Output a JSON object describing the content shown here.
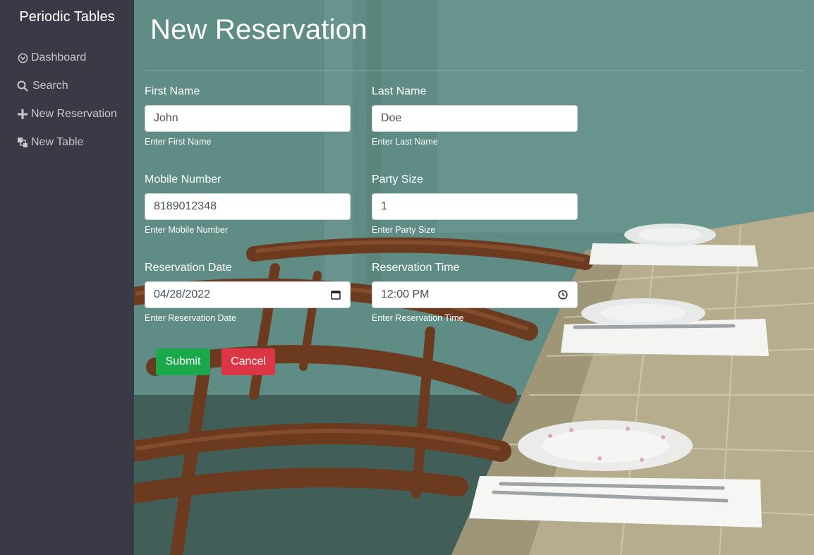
{
  "sidebar": {
    "brand": "Periodic Tables",
    "items": [
      {
        "label": "Dashboard",
        "icon": "dashboard-icon"
      },
      {
        "label": "Search",
        "icon": "search-icon"
      },
      {
        "label": "New Reservation",
        "icon": "plus-icon"
      },
      {
        "label": "New Table",
        "icon": "layers-icon"
      }
    ]
  },
  "main": {
    "title": "New Reservation",
    "form": {
      "first_name": {
        "label": "First Name",
        "value": "John",
        "hint": "Enter First Name"
      },
      "last_name": {
        "label": "Last Name",
        "value": "Doe",
        "hint": "Enter Last Name"
      },
      "mobile_number": {
        "label": "Mobile Number",
        "value": "8189012348",
        "hint": "Enter Mobile Number"
      },
      "party_size": {
        "label": "Party Size",
        "value": "1",
        "hint": "Enter Party Size"
      },
      "reservation_date": {
        "label": "Reservation Date",
        "value": "04/28/2022",
        "hint": "Enter Reservation Date",
        "icon": "calendar-icon"
      },
      "reservation_time": {
        "label": "Reservation Time",
        "value": "12:00 PM",
        "hint": "Enter Reservation Time",
        "icon": "clock-icon"
      }
    },
    "buttons": {
      "submit": "Submit",
      "cancel": "Cancel"
    }
  },
  "colors": {
    "sidebar_bg": "#3a3a46",
    "submit": "#1aa84a",
    "cancel": "#dc3545"
  }
}
